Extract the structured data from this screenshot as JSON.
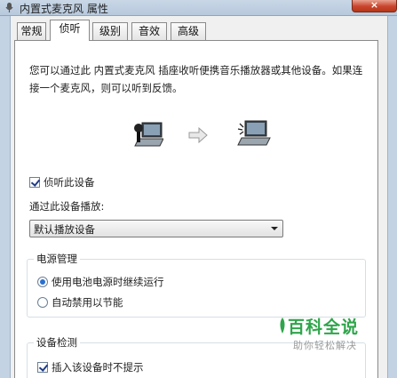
{
  "window": {
    "title": "内置式麦克风 属性",
    "close_label": "×"
  },
  "tabs": [
    {
      "label": "常规",
      "active": false
    },
    {
      "label": "侦听",
      "active": true
    },
    {
      "label": "级别",
      "active": false
    },
    {
      "label": "音效",
      "active": false
    },
    {
      "label": "高级",
      "active": false
    }
  ],
  "listen": {
    "description": "您可以通过此 内置式麦克风 插座收听便携音乐播放器或其他设备。如果连接一个麦克风，则可以听到反馈。",
    "listen_checkbox": {
      "label": "侦听此设备",
      "checked": true
    },
    "playback_label": "通过此设备播放:",
    "playback_select": {
      "value": "默认播放设备"
    }
  },
  "power": {
    "title": "电源管理",
    "options": [
      {
        "label": "使用电池电源时继续运行",
        "selected": true
      },
      {
        "label": "自动禁用以节能",
        "selected": false
      }
    ]
  },
  "detection": {
    "title": "设备检测",
    "checkbox": {
      "label": "插入该设备时不提示",
      "checked": true
    }
  },
  "watermark": {
    "main": "百科全说",
    "sub": "助你轻松解决"
  }
}
